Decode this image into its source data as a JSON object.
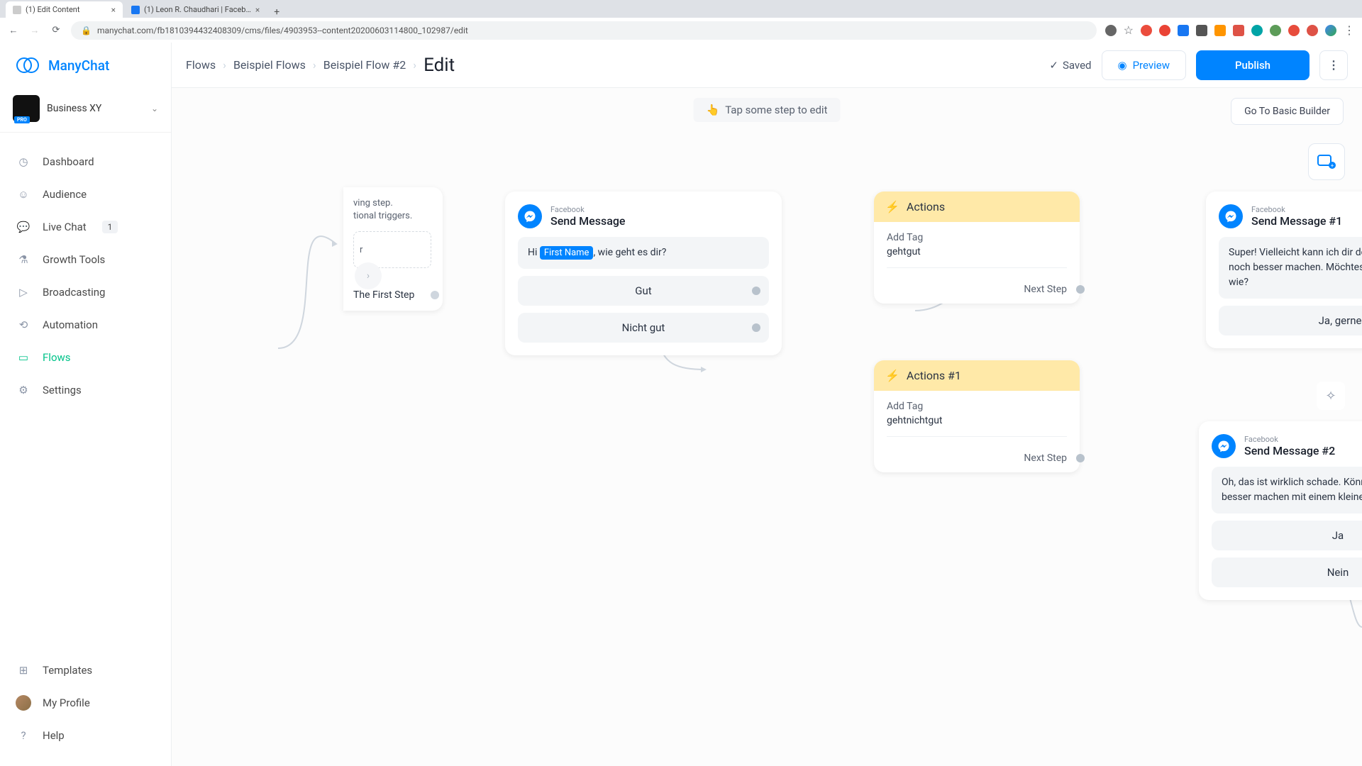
{
  "browser": {
    "tabs": [
      {
        "title": "(1) Edit Content",
        "active": true
      },
      {
        "title": "(1) Leon R. Chaudhari | Faceb…",
        "active": false
      }
    ],
    "url": "manychat.com/fb181039443240830­9/cms/files/4903953--content20200603114800_102987/edit"
  },
  "brand": "ManyChat",
  "account": {
    "name": "Business XY",
    "badge": "PRO"
  },
  "nav": {
    "dashboard": "Dashboard",
    "audience": "Audience",
    "live_chat": "Live Chat",
    "live_chat_badge": "1",
    "growth": "Growth Tools",
    "broadcasting": "Broadcasting",
    "automation": "Automation",
    "flows": "Flows",
    "settings": "Settings",
    "templates": "Templates",
    "profile": "My Profile",
    "help": "Help"
  },
  "breadcrumbs": {
    "c1": "Flows",
    "c2": "Beispiel Flows",
    "c3": "Beispiel Flow #2",
    "c4": "Edit"
  },
  "topbar": {
    "saved": "Saved",
    "preview": "Preview",
    "publish": "Publish",
    "hint": "Tap some step to edit",
    "basic": "Go To Basic Builder"
  },
  "starter": {
    "line1": "ving step.",
    "line2": "tional triggers.",
    "trigger_placeholder": "r",
    "first_step": "The First Step"
  },
  "msg1": {
    "platform": "Facebook",
    "title": "Send Message",
    "prefix": "Hi ",
    "var": "First Name",
    "suffix": ", wie geht es dir?",
    "btn1": "Gut",
    "btn2": "Nicht gut"
  },
  "actions1": {
    "title": "Actions",
    "item_label": "Add Tag",
    "item_value": "gehtgut",
    "next": "Next Step"
  },
  "actions2": {
    "title": "Actions #1",
    "item_label": "Add Tag",
    "item_value": "gehtnichtgut",
    "next": "Next Step"
  },
  "msg2": {
    "platform": "Facebook",
    "title": "Send Message #1",
    "body": "Super! Vielleicht kann ich dir deinen Tag heute noch besser machen. Möchtest du gerne wissen wie?",
    "btn1": "Ja, gerne!"
  },
  "msg3": {
    "platform": "Facebook",
    "title": "Send Message #2",
    "body": "Oh, das ist wirklich schade. Könnte ich deinen Tag besser machen mit einem kleinen Geschenk?",
    "btn1": "Ja",
    "btn2": "Nein"
  }
}
